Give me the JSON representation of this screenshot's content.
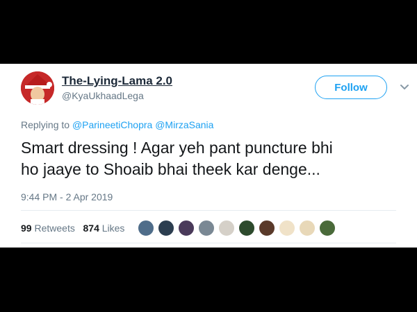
{
  "tweet": {
    "display_name": "The-Lying-Lama 2.0",
    "handle": "@KyaUkhaadLega",
    "follow_label": "Follow",
    "replying_prefix": "Replying to",
    "reply_mentions": [
      "@ParineetiChopra",
      "@MirzaSania"
    ],
    "text_line1": "Smart dressing ! Agar yeh pant puncture bhi",
    "text_line2": "ho jaaye to Shoaib bhai theek kar denge...",
    "timestamp": "9:44 PM - 2 Apr 2019",
    "retweets_count": "99",
    "retweets_label": "Retweets",
    "likes_count": "874",
    "likes_label": "Likes"
  },
  "icons": {
    "menu": "chevron-down-icon"
  },
  "colors": {
    "accent": "#1da1f2",
    "text": "#14171a",
    "muted": "#657786",
    "name": "#1c2938"
  },
  "likers": [
    "#4f6d8a",
    "#2c3e50",
    "#4a3a5a",
    "#7a8894",
    "#d5d0c8",
    "#2d4a2d",
    "#5a3a2a",
    "#f0e2c8",
    "#e8d8b8",
    "#4a6a3a"
  ]
}
